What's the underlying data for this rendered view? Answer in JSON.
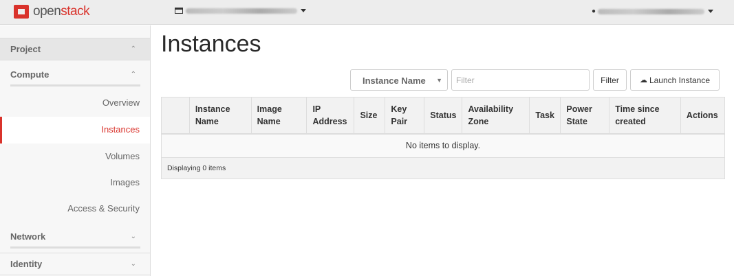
{
  "header": {
    "logo_text_a": "open",
    "logo_text_b": "stack"
  },
  "sidebar": {
    "project": "Project",
    "compute": "Compute",
    "items": [
      {
        "label": "Overview"
      },
      {
        "label": "Instances"
      },
      {
        "label": "Volumes"
      },
      {
        "label": "Images"
      },
      {
        "label": "Access & Security"
      }
    ],
    "network": "Network",
    "identity": "Identity",
    "active_color": "#d9322b"
  },
  "main": {
    "title": "Instances",
    "filter_field": "Instance Name",
    "filter_placeholder": "Filter",
    "filter_button": "Filter",
    "launch_button": "Launch Instance",
    "columns": [
      "",
      "Instance Name",
      "Image Name",
      "IP Address",
      "Size",
      "Key Pair",
      "Status",
      "Availability Zone",
      "Task",
      "Power State",
      "Time since created",
      "Actions"
    ],
    "empty_message": "No items to display.",
    "footer": "Displaying 0 items"
  }
}
